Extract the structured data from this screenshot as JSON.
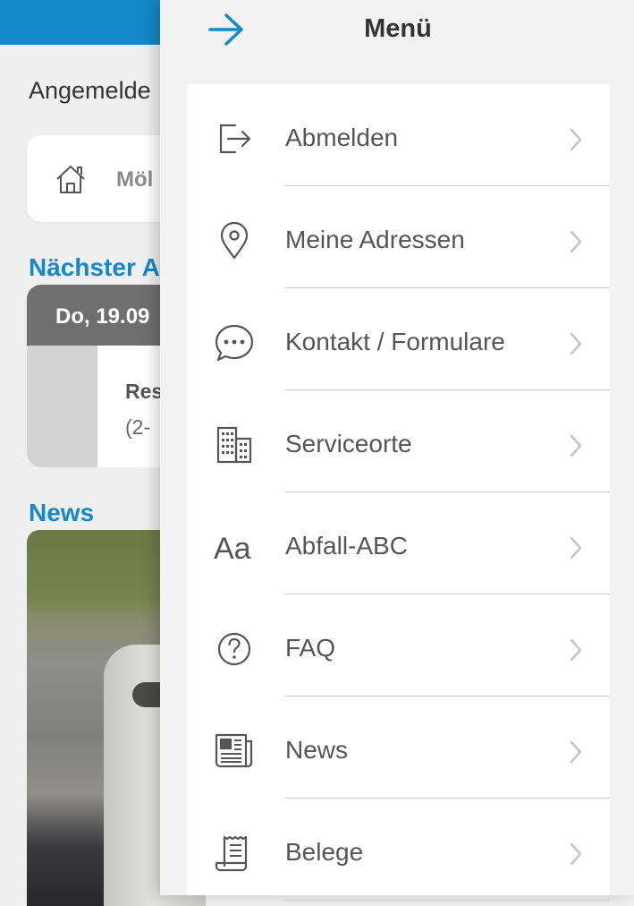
{
  "background": {
    "greeting": "Angemelde",
    "address_card": {
      "icon": "home-icon",
      "text": "Möl"
    },
    "next_pickup": {
      "title": "Nächster A",
      "date": "Do, 19.09",
      "type": "Res",
      "detail": "(2-"
    },
    "news_title": "News"
  },
  "drawer": {
    "back_icon": "arrow-right-icon",
    "title": "Menü",
    "items": [
      {
        "icon": "logout-icon",
        "label": "Abmelden"
      },
      {
        "icon": "location-pin-icon",
        "label": "Meine Adressen"
      },
      {
        "icon": "chat-bubble-icon",
        "label": "Kontakt / Formulare"
      },
      {
        "icon": "buildings-icon",
        "label": "Serviceorte"
      },
      {
        "icon": "font-aa-icon",
        "label": "Abfall-ABC",
        "icon_text": "Aa"
      },
      {
        "icon": "question-circle-icon",
        "label": "FAQ"
      },
      {
        "icon": "newspaper-icon",
        "label": "News"
      },
      {
        "icon": "receipt-icon",
        "label": "Belege"
      }
    ]
  },
  "colors": {
    "accent": "#1488c8",
    "menu_background": "#f2f2f2",
    "text": "#555555"
  }
}
